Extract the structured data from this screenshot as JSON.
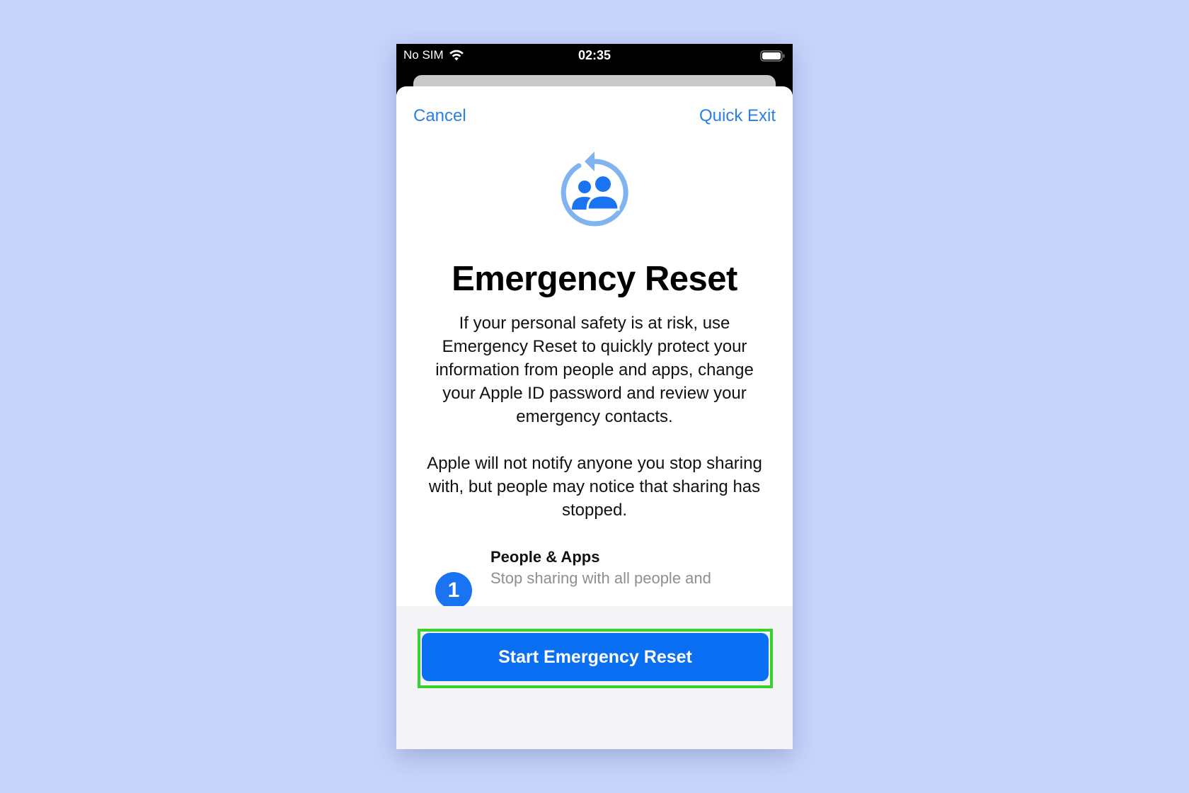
{
  "status_bar": {
    "carrier": "No SIM",
    "time": "02:35"
  },
  "nav": {
    "cancel_label": "Cancel",
    "quick_exit_label": "Quick Exit"
  },
  "hero": {
    "icon": "people-reset-icon",
    "title": "Emergency Reset",
    "paragraph_1": "If your personal safety is at risk, use Emergency Reset to quickly protect your information from people and apps, change your Apple ID password and review your emergency contacts.",
    "paragraph_2": "Apple will not notify anyone you stop sharing with, but people may notice that sharing has stopped."
  },
  "steps": [
    {
      "number": "1",
      "title": "People & Apps",
      "description": "Stop sharing with all people and"
    }
  ],
  "footer": {
    "primary_button_label": "Start Emergency Reset"
  },
  "colors": {
    "background": "#c6d3fb",
    "accent": "#0a6ff2",
    "link": "#2a7fe6",
    "highlight": "#39d12e",
    "secondary_text": "#8e8e93"
  }
}
